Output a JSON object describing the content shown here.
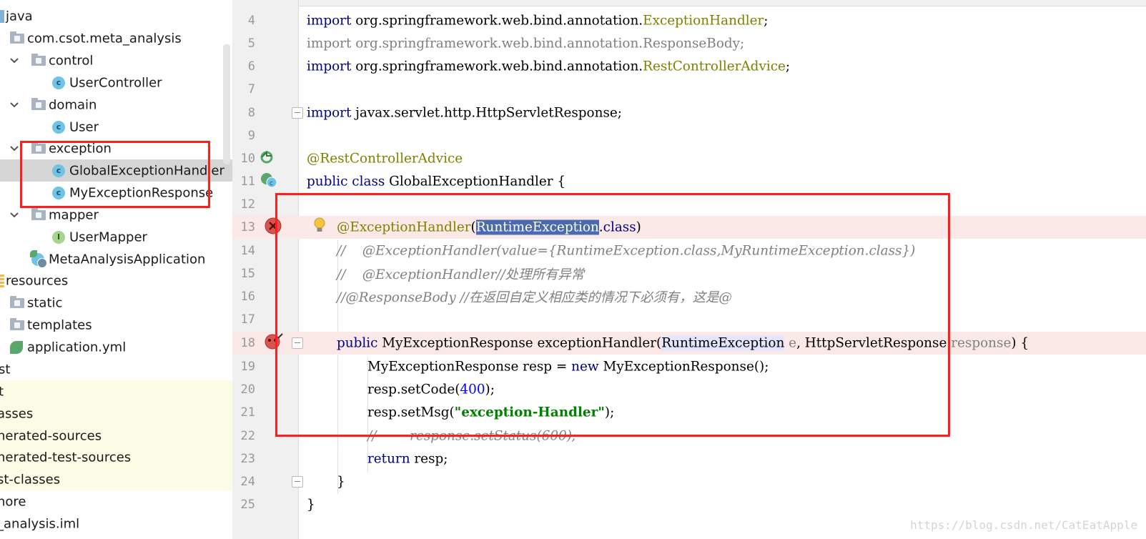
{
  "tree": {
    "items": [
      {
        "label": "java",
        "state": "",
        "icon": "source-root-icon"
      },
      {
        "label": "com.csot.meta_analysis",
        "state": "",
        "icon": "package-icon"
      },
      {
        "label": "control",
        "state": "",
        "icon": "package-icon"
      },
      {
        "label": "UserController",
        "state": "",
        "icon": "class-icon"
      },
      {
        "label": "domain",
        "state": "",
        "icon": "package-icon"
      },
      {
        "label": "User",
        "state": "",
        "icon": "class-icon"
      },
      {
        "label": "exception",
        "state": "",
        "icon": "package-icon"
      },
      {
        "label": "GlobalExceptionHandler",
        "state": "selected",
        "icon": "class-icon"
      },
      {
        "label": "MyExceptionResponse",
        "state": "",
        "icon": "class-icon"
      },
      {
        "label": "mapper",
        "state": "",
        "icon": "package-icon"
      },
      {
        "label": "UserMapper",
        "state": "",
        "icon": "interface-icon"
      },
      {
        "label": "MetaAnalysisApplication",
        "state": "",
        "icon": "spring-boot-class-icon"
      },
      {
        "label": "resources",
        "state": "",
        "icon": "resources-root-icon"
      },
      {
        "label": "static",
        "state": "",
        "icon": "folder-icon"
      },
      {
        "label": "templates",
        "state": "",
        "icon": "folder-icon"
      },
      {
        "label": "application.yml",
        "state": "",
        "icon": "spring-yml-icon"
      },
      {
        "label": "st",
        "state": "",
        "icon": ""
      },
      {
        "label": "t",
        "state": "excluded",
        "icon": ""
      },
      {
        "label": "asses",
        "state": "excluded",
        "icon": ""
      },
      {
        "label": "nerated-sources",
        "state": "excluded",
        "icon": ""
      },
      {
        "label": "nerated-test-sources",
        "state": "excluded",
        "icon": ""
      },
      {
        "label": "st-classes",
        "state": "excluded",
        "icon": ""
      },
      {
        "label": "nore",
        "state": "",
        "icon": ""
      },
      {
        "label": "_analysis.iml",
        "state": "",
        "icon": ""
      }
    ],
    "code_lines": [
      {
        "n": "4"
      },
      {
        "n": "5"
      },
      {
        "n": "6"
      },
      {
        "n": "7"
      },
      {
        "n": "8"
      },
      {
        "n": "9"
      },
      {
        "n": "10"
      },
      {
        "n": "11"
      },
      {
        "n": "12"
      },
      {
        "n": "13"
      },
      {
        "n": "14"
      },
      {
        "n": "15"
      },
      {
        "n": "16"
      },
      {
        "n": "17"
      },
      {
        "n": "18"
      },
      {
        "n": "19"
      },
      {
        "n": "20"
      },
      {
        "n": "21"
      },
      {
        "n": "22"
      },
      {
        "n": "23"
      },
      {
        "n": "24"
      },
      {
        "n": "25"
      }
    ]
  },
  "code": {
    "l4": [
      "import",
      " org.springframework.web.bind.annotation.",
      "ExceptionHandler",
      ";"
    ],
    "l5": [
      "import org.springframework.web.bind.annotation.ResponseBody;"
    ],
    "l6": [
      "import",
      " org.springframework.web.bind.annotation.",
      "RestControllerAdvice",
      ";"
    ],
    "l8": [
      "import",
      " javax.servlet.http.HttpServletResponse;"
    ],
    "l10": [
      "@RestControllerAdvice"
    ],
    "l11": [
      "public class",
      " GlobalExceptionHandler {"
    ],
    "l13": [
      "@ExceptionHandler",
      "(",
      "RuntimeException",
      ".",
      "class",
      ")"
    ],
    "l14": [
      "//    @ExceptionHandler(value={RuntimeException.class,MyRuntimeException.class})"
    ],
    "l15": [
      "//    @ExceptionHandler//处理所有异常"
    ],
    "l16": [
      "//@ResponseBody //在返回自定义相应类的情况下必须有，这是@"
    ],
    "l18": [
      "public",
      " MyExceptionResponse exceptionHandler(",
      "RuntimeException",
      " e",
      ", HttpServletResponse ",
      "response",
      ") {"
    ],
    "l19": [
      "MyExceptionResponse resp = ",
      "new",
      " MyExceptionResponse();"
    ],
    "l20": [
      "resp.setCode(",
      "400",
      ");"
    ],
    "l21": [
      "resp.setMsg(",
      "\"exception-Handler\"",
      ");"
    ],
    "l22": [
      "//        response.setStatus(600);"
    ],
    "l23": [
      "return",
      " resp;"
    ],
    "l24": [
      "}"
    ],
    "l25": [
      "}"
    ]
  },
  "watermark": "https://blog.csdn.net/CatEatApple",
  "colors": {
    "highlight_box": "#ff1e1e",
    "selection": "#4b6ab0",
    "error_line": "#fbe9e7"
  }
}
